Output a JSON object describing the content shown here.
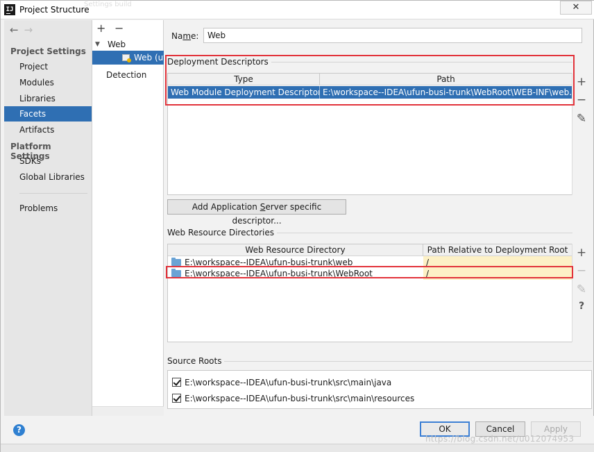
{
  "window": {
    "title": "Project Structure",
    "app_icon": "IJ",
    "close_symbol": "✕",
    "background_hint": "Settings   build"
  },
  "nav": {
    "back_symbol": "←",
    "forward_symbol": "→",
    "project_settings_heading": "Project Settings",
    "project_items": [
      "Project",
      "Modules",
      "Libraries",
      "Facets",
      "Artifacts"
    ],
    "selected_item": "Facets",
    "platform_settings_heading": "Platform Settings",
    "platform_items": [
      "SDKs",
      "Global Libraries"
    ],
    "problems_label": "Problems"
  },
  "facet_tree": {
    "add_symbol": "+",
    "remove_symbol": "−",
    "expand_symbol": "▼",
    "group_label": "Web",
    "selected_label": "Web (ufun",
    "detection_label": "Detection"
  },
  "name_field": {
    "label_prefix": "Na",
    "label_mnemonic": "m",
    "label_suffix": "e:",
    "value": "Web"
  },
  "deployment_descriptors": {
    "title": "Deployment Descriptors",
    "columns": [
      "Type",
      "Path"
    ],
    "rows": [
      {
        "type": "Web Module Deployment Descriptor",
        "path": "E:\\workspace--IDEA\\ufun-busi-trunk\\WebRoot\\WEB-INF\\web.xml"
      }
    ],
    "add_server_button_prefix": "Add Application ",
    "add_server_button_mnemonic": "S",
    "add_server_button_suffix": "erver specific descriptor..."
  },
  "web_resource_directories": {
    "title": "Web Resource Directories",
    "columns": [
      "Web Resource Directory",
      "Path Relative to Deployment Root"
    ],
    "rows": [
      {
        "directory": "E:\\workspace--IDEA\\ufun-busi-trunk\\web",
        "relative": "/"
      },
      {
        "directory": "E:\\workspace--IDEA\\ufun-busi-trunk\\WebRoot",
        "relative": "/"
      }
    ]
  },
  "side_tools": {
    "add": "+",
    "remove": "−",
    "edit_icon": "pencil-icon",
    "edit": "✎",
    "help": "?"
  },
  "source_roots": {
    "title": "Source Roots",
    "items": [
      {
        "path": "E:\\workspace--IDEA\\ufun-busi-trunk\\src\\main\\java",
        "checked": true
      },
      {
        "path": "E:\\workspace--IDEA\\ufun-busi-trunk\\src\\main\\resources",
        "checked": true
      }
    ]
  },
  "footer": {
    "help_symbol": "?",
    "ok_label": "OK",
    "cancel_label": "Cancel",
    "apply_label": "Apply",
    "watermark": "https://blog.csdn.net/u012074953"
  },
  "colors": {
    "selection_blue": "#2f6fb3",
    "highlight_red": "#e2323a",
    "path_yellow": "#fdf1c6"
  }
}
